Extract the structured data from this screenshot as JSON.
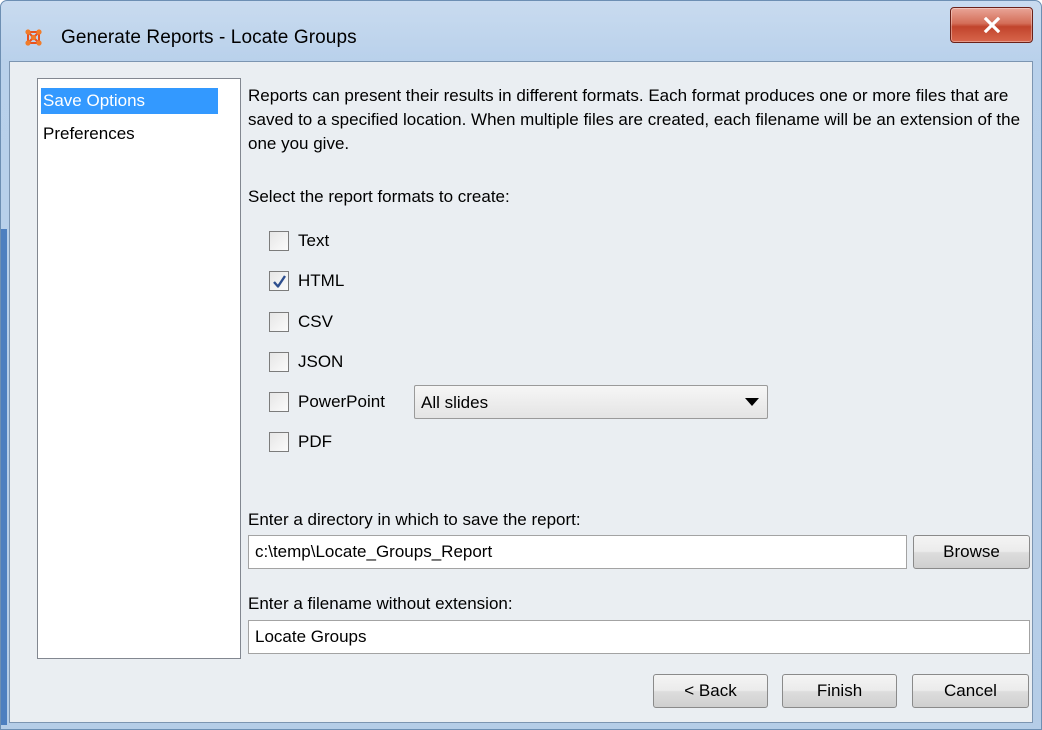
{
  "window": {
    "title": "Generate Reports - Locate Groups"
  },
  "nav": {
    "items": [
      {
        "label": "Save Options",
        "selected": true
      },
      {
        "label": "Preferences",
        "selected": false
      }
    ]
  },
  "content": {
    "description": "Reports can present their results in different formats. Each format produces one or more files that are saved to a specified location. When multiple files are created, each filename will be an extension of the one you give.",
    "formats_prompt": "Select the report formats to create:",
    "formats": [
      {
        "label": "Text",
        "checked": false
      },
      {
        "label": "HTML",
        "checked": true
      },
      {
        "label": "CSV",
        "checked": false
      },
      {
        "label": "JSON",
        "checked": false
      },
      {
        "label": "PowerPoint",
        "checked": false
      },
      {
        "label": "PDF",
        "checked": false
      }
    ],
    "powerpoint_option": {
      "value": "All slides"
    },
    "directory_prompt": "Enter a directory in which to save the report:",
    "directory_value": "c:\\temp\\Locate_Groups_Report",
    "browse_label": "Browse",
    "filename_prompt": "Enter a filename without extension:",
    "filename_value": "Locate Groups"
  },
  "buttons": {
    "back": "< Back",
    "finish": "Finish",
    "cancel": "Cancel"
  },
  "colors": {
    "selection": "#3399ff",
    "close_button": "#c7503a",
    "window_frame": "#b9d1eb",
    "app_icon": "#e8521e"
  },
  "icons": {
    "app": "network-graph-icon",
    "close": "close-x-icon",
    "checkmark": "checkmark-icon",
    "dropdown": "triangle-down-icon"
  }
}
